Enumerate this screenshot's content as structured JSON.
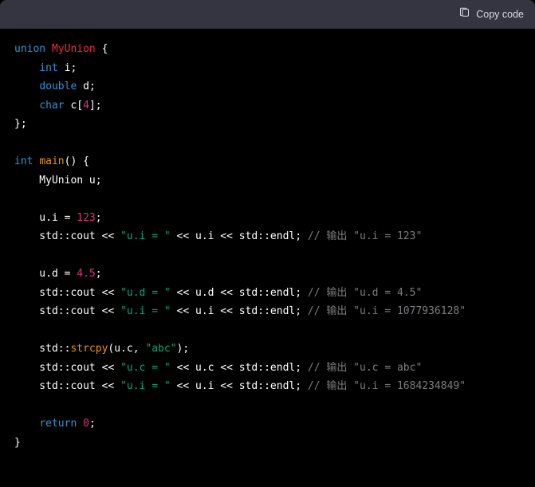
{
  "header": {
    "copy_label": "Copy code"
  },
  "code": {
    "l1_kw": "union",
    "l1_name": "MyUnion",
    "l1_open": " {",
    "l2_kw": "int",
    "l2_rest": " i;",
    "l3_kw": "double",
    "l3_rest": " d;",
    "l4_kw": "char",
    "l4_mid": " c[",
    "l4_num": "4",
    "l4_end": "];",
    "l5": "};",
    "blank": "",
    "l7_kw": "int",
    "l7_fn": "main",
    "l7_rest": "() {",
    "l8": "    MyUnion u;",
    "l10_a": "    u.i = ",
    "l10_num": "123",
    "l10_end": ";",
    "l11_a": "    std::cout << ",
    "l11_str": "\"u.i = \"",
    "l11_b": " << u.i << std::endl; ",
    "l11_cmt": "// 输出 \"u.i = 123\"",
    "l13_a": "    u.d = ",
    "l13_num": "4.5",
    "l13_end": ";",
    "l14_a": "    std::cout << ",
    "l14_str": "\"u.d = \"",
    "l14_b": " << u.d << std::endl; ",
    "l14_cmt": "// 输出 \"u.d = 4.5\"",
    "l15_a": "    std::cout << ",
    "l15_str": "\"u.i = \"",
    "l15_b": " << u.i << std::endl; ",
    "l15_cmt": "// 输出 \"u.i = 1077936128\"",
    "l17_a": "    std::",
    "l17_fn": "strcpy",
    "l17_b": "(u.c, ",
    "l17_str": "\"abc\"",
    "l17_end": ");",
    "l18_a": "    std::cout << ",
    "l18_str": "\"u.c = \"",
    "l18_b": " << u.c << std::endl; ",
    "l18_cmt": "// 输出 \"u.c = abc\"",
    "l19_a": "    std::cout << ",
    "l19_str": "\"u.i = \"",
    "l19_b": " << u.i << std::endl; ",
    "l19_cmt": "// 输出 \"u.i = 1684234849\"",
    "l21_kw": "return",
    "l21_sp": " ",
    "l21_num": "0",
    "l21_end": ";",
    "l22": "}"
  }
}
